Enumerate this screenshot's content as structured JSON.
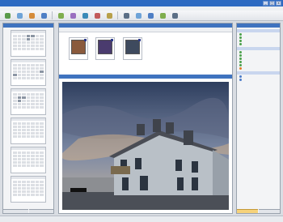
{
  "window": {
    "title": "",
    "buttons": [
      "_",
      "□",
      "x"
    ]
  },
  "menubar": {
    "items": [
      "",
      "",
      "",
      "",
      "",
      ""
    ]
  },
  "toolbar": {
    "buttons": [
      {
        "name": "",
        "color": "#5a9a4a"
      },
      {
        "name": "",
        "color": "#6ea3d8"
      },
      {
        "name": "",
        "color": "#d58b3a"
      },
      {
        "name": "",
        "color": "#4f7fc5"
      },
      {
        "name": "",
        "color": "#7fae4e"
      },
      {
        "name": "",
        "color": "#9a6fc0"
      },
      {
        "name": "",
        "color": "#3b8ab8"
      },
      {
        "name": "",
        "color": "#c25a5a"
      },
      {
        "name": "",
        "color": "#b8a04a"
      },
      {
        "name": "",
        "color": "#5b6f86"
      },
      {
        "name": "",
        "color": "#6ea3d8"
      },
      {
        "name": "",
        "color": "#4f7fc5"
      },
      {
        "name": "",
        "color": "#7fae4e"
      },
      {
        "name": "",
        "color": "#5b6f86"
      }
    ]
  },
  "left_panel": {
    "header": "",
    "tabs": [
      "",
      ""
    ],
    "calendars": [
      {
        "month": "",
        "marked": [
          3,
          4,
          10
        ]
      },
      {
        "month": "",
        "marked": [
          20,
          21
        ]
      },
      {
        "month": "",
        "marked": [
          8,
          9,
          15
        ]
      },
      {
        "month": "",
        "marked": []
      },
      {
        "month": "",
        "marked": []
      },
      {
        "month": "",
        "marked": []
      }
    ]
  },
  "center": {
    "header": "",
    "thumbnails": [
      {
        "caption": "",
        "color": "#8a5a3c"
      },
      {
        "caption": "",
        "color": "#4a3b6e"
      },
      {
        "caption": "",
        "color": "#3e4a5e"
      }
    ],
    "preview_header": "",
    "preview_label": ""
  },
  "right_panel": {
    "header": "",
    "sections": [
      {
        "title": "",
        "items": [
          {
            "label": "",
            "color": "#4aa04a"
          },
          {
            "label": "",
            "color": "#4aa04a"
          },
          {
            "label": "",
            "color": "#4aa04a"
          },
          {
            "label": "",
            "color": "#4aa04a"
          }
        ]
      },
      {
        "title": "",
        "items": [
          {
            "label": "",
            "color": "#4aa04a"
          },
          {
            "label": "",
            "color": "#4aa04a"
          },
          {
            "label": "",
            "color": "#4aa04a"
          },
          {
            "label": "",
            "color": "#4aa04a"
          },
          {
            "label": "",
            "color": "#4aa04a"
          },
          {
            "label": "",
            "color": "#e07a2a"
          }
        ]
      },
      {
        "title": "",
        "items": [
          {
            "label": "",
            "color": "#4a7ac8"
          },
          {
            "label": "",
            "color": "#4a7ac8"
          }
        ]
      }
    ],
    "tabs": [
      "",
      ""
    ]
  },
  "statusbar": {
    "text": ""
  }
}
